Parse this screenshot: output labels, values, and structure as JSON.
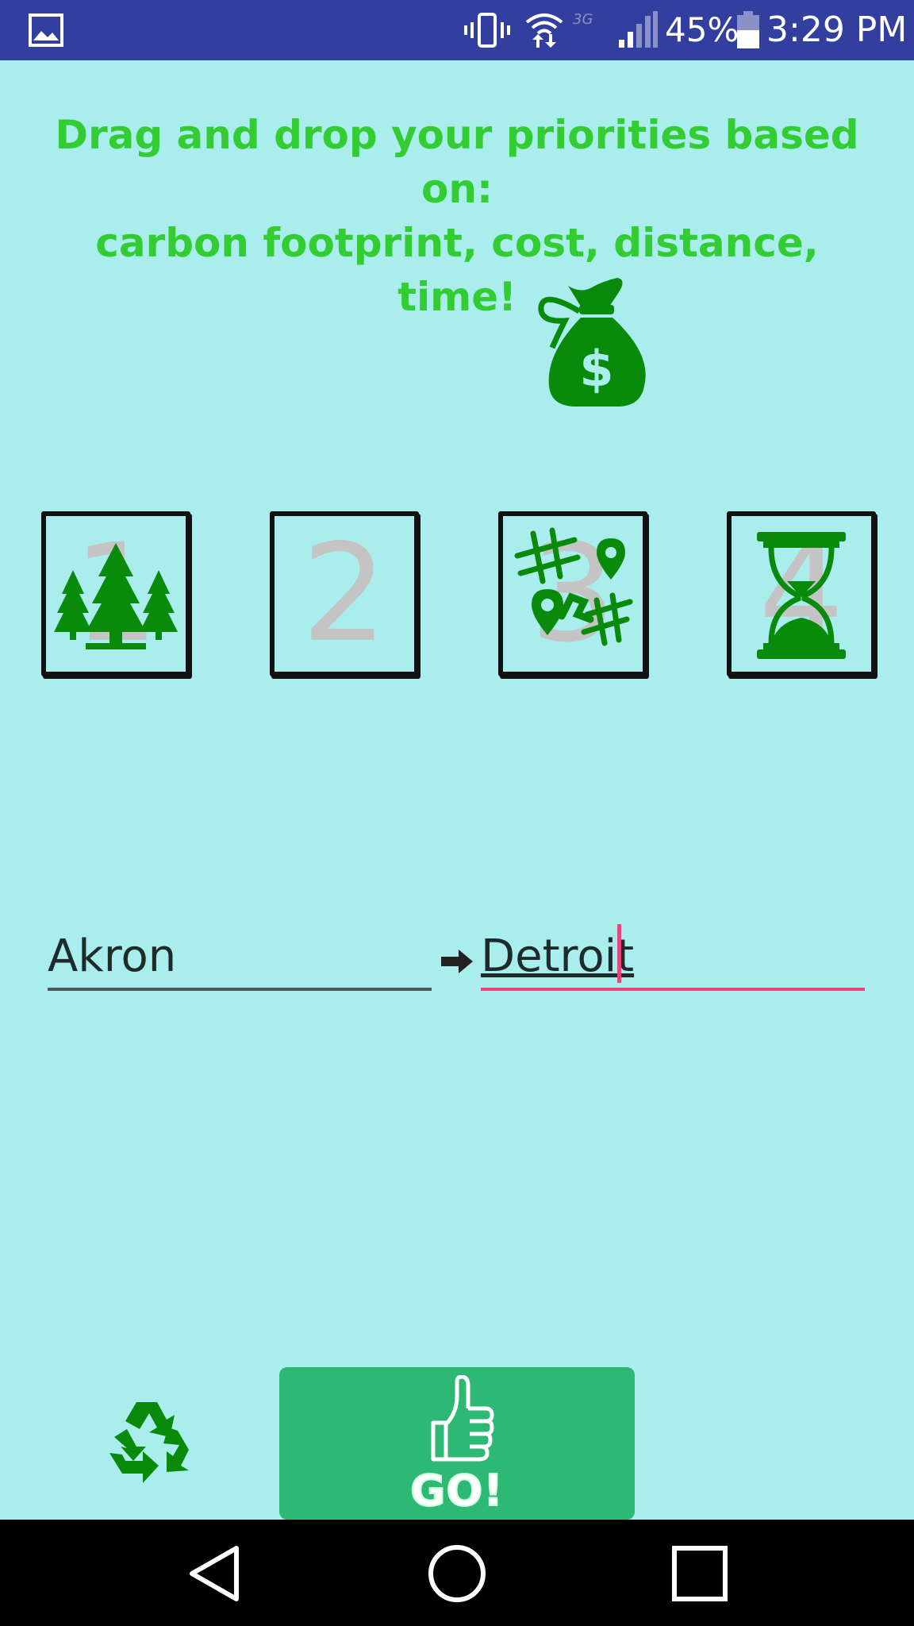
{
  "status_bar": {
    "network_type": "3G",
    "battery_percent": "45%",
    "time": "3:29 PM",
    "icons": [
      "gallery-icon",
      "vibrate-icon",
      "wifi-icon",
      "signal-icon",
      "battery-icon"
    ]
  },
  "header": {
    "line1": "Drag and drop your priorities based on:",
    "line2": "carbon footprint, cost, distance, time!"
  },
  "draggable": {
    "icon": "money-bag-icon"
  },
  "slots": [
    {
      "number": "1",
      "icon": "trees-icon"
    },
    {
      "number": "2",
      "icon": ""
    },
    {
      "number": "3",
      "icon": "map-icon"
    },
    {
      "number": "4",
      "icon": "hourglass-icon"
    }
  ],
  "route": {
    "from_value": "Akron",
    "to_value": "Detroit",
    "separator_icon": "arrow-right-icon"
  },
  "actions": {
    "reset_icon": "recycle-icon",
    "go_label": "GO!",
    "go_icon": "thumbs-up-icon"
  },
  "colors": {
    "background": "#a9eded",
    "status_bar": "#333f9e",
    "headline": "#33cc33",
    "icon_green": "#0a8a0a",
    "go_button": "#2db873",
    "focus_accent": "#e8447e"
  }
}
